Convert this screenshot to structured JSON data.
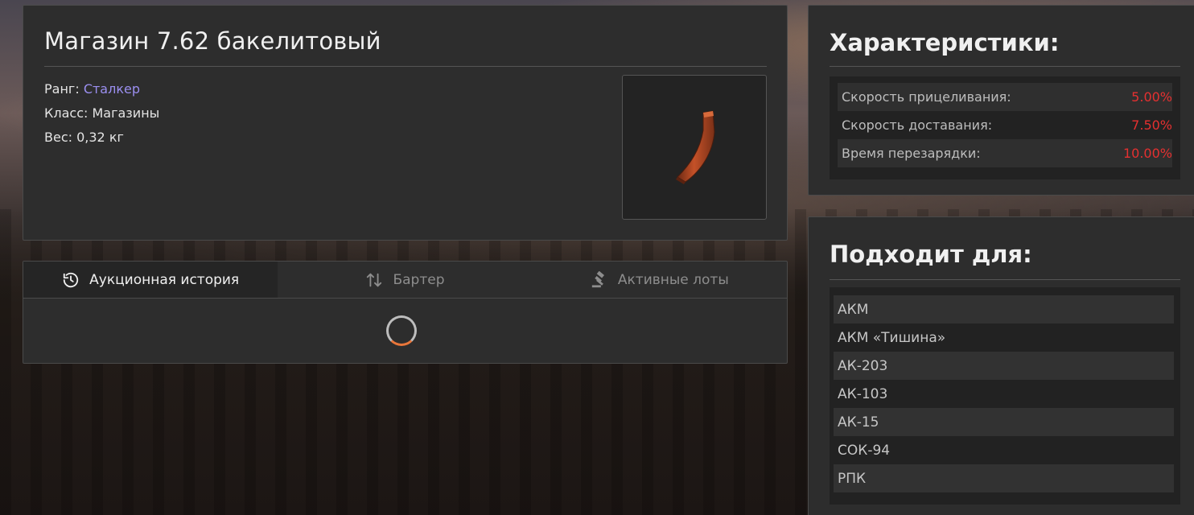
{
  "item": {
    "title": "Магазин 7.62 бакелитовый",
    "rank_label": "Ранг:",
    "rank_value": "Сталкер",
    "class_label": "Класс:",
    "class_value": "Магазины",
    "weight_label": "Вес:",
    "weight_value": "0,32 кг",
    "image_icon": "ak-magazine-icon"
  },
  "tabs": [
    {
      "label": "Аукционная история",
      "icon": "history-icon",
      "active": true
    },
    {
      "label": "Бартер",
      "icon": "swap-arrows-icon",
      "active": false
    },
    {
      "label": "Активные лоты",
      "icon": "gavel-icon",
      "active": false
    }
  ],
  "stats": {
    "heading": "Характеристики:",
    "rows": [
      {
        "name": "Скорость прицеливания:",
        "value": "5.00%"
      },
      {
        "name": "Скорость доставания:",
        "value": "7.50%"
      },
      {
        "name": "Время перезарядки:",
        "value": "10.00%"
      }
    ],
    "value_color": "#e53030"
  },
  "compatible": {
    "heading": "Подходит для:",
    "items": [
      "АКМ",
      "АКМ «Тишина»",
      "АК-203",
      "АК-103",
      "АК-15",
      "СОК-94",
      "РПК"
    ]
  },
  "colors": {
    "rank": "#9b8ff0",
    "spinner_accent": "#e8763a",
    "panel_bg": "#2d2d2d"
  }
}
